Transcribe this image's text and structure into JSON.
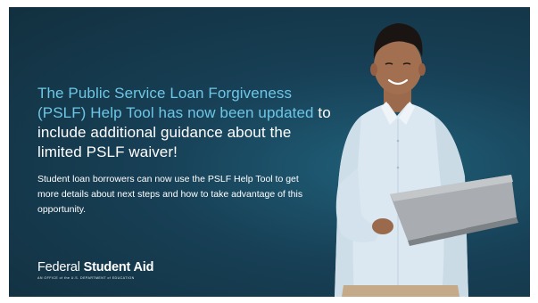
{
  "headline": {
    "accent": "The Public Service Loan Forgiveness (PSLF) Help Tool has now been updated",
    "rest": "to include additional guidance about the limited PSLF waiver!"
  },
  "body_text": "Student loan borrowers can now use the PSLF Help Tool to get more details about next steps and how to take advantage of this opportunity.",
  "logo": {
    "word1": "Federal",
    "word2": "Student Aid",
    "tagline": "AN OFFICE of the U.S. DEPARTMENT of EDUCATION"
  },
  "colors": {
    "background": "#173f55",
    "accent_text": "#6ec6e6",
    "text": "#ffffff"
  },
  "image": {
    "subject": "smiling man in light blue shirt holding a laptop"
  }
}
